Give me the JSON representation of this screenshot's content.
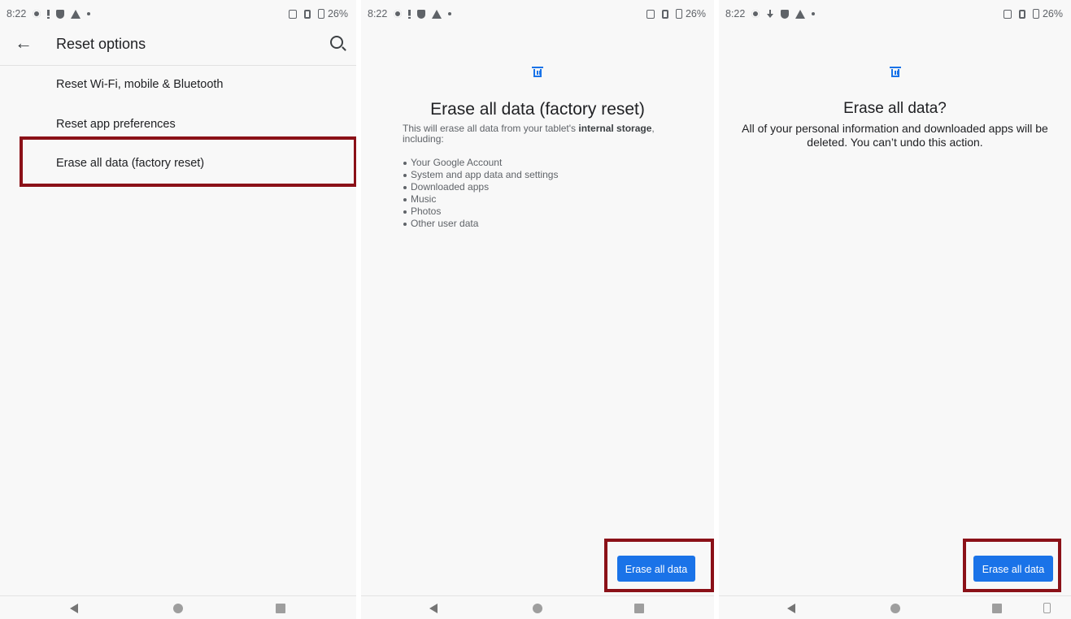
{
  "status": {
    "time": "8:22",
    "battery": "26%"
  },
  "screen1": {
    "title": "Reset options",
    "items": [
      "Reset Wi-Fi, mobile & Bluetooth",
      "Reset app preferences",
      "Erase all data (factory reset)"
    ]
  },
  "screen2": {
    "title": "Erase all data (factory reset)",
    "desc_prefix": "This will erase all data from your tablet's ",
    "desc_bold": "internal storage",
    "desc_suffix": ",",
    "desc_line2": "including:",
    "bullets": [
      "Your Google Account",
      "System and app data and settings",
      "Downloaded apps",
      "Music",
      "Photos",
      "Other user data"
    ],
    "button": "Erase all data"
  },
  "screen3": {
    "title": "Erase all data?",
    "desc": "All of your personal information and downloaded apps will be deleted. You can’t undo this action.",
    "button": "Erase all data"
  },
  "colors": {
    "accent": "#1a73e8",
    "highlight": "#8b1118",
    "background": "#f8f8f8"
  },
  "icons": [
    "settings-icon",
    "alert-icon",
    "download-icon",
    "shield-icon",
    "warning-icon",
    "nfc-icon",
    "vibrate-icon",
    "battery-icon",
    "back-arrow-icon",
    "search-icon",
    "trash-icon",
    "nav-back-icon",
    "nav-home-icon",
    "nav-recents-icon",
    "rotate-icon"
  ]
}
